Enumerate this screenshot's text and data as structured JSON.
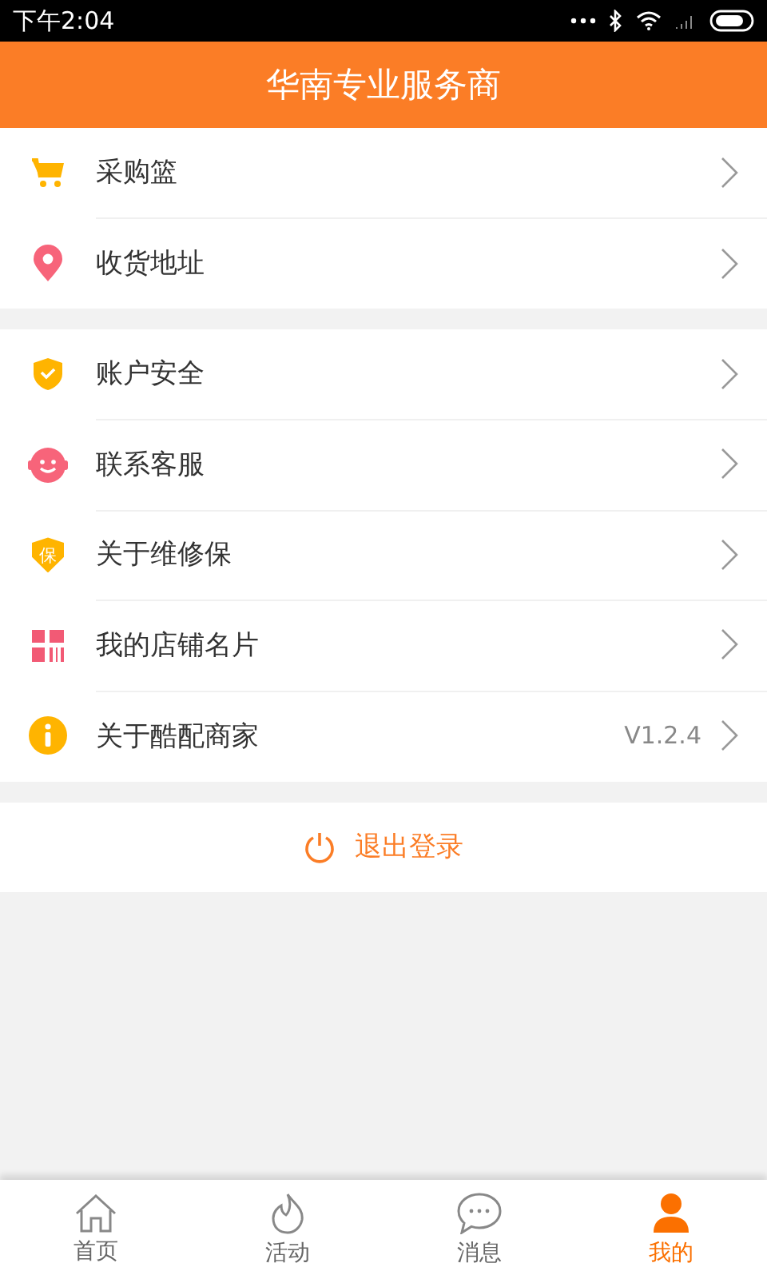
{
  "status_bar": {
    "time": "下午2:04"
  },
  "header": {
    "title": "华南专业服务商"
  },
  "groups": [
    {
      "items": [
        {
          "kind": "cart",
          "label": "采购篮"
        },
        {
          "kind": "pin",
          "label": "收货地址"
        }
      ]
    },
    {
      "items": [
        {
          "kind": "shield",
          "label": "账户安全"
        },
        {
          "kind": "headset",
          "label": "联系客服"
        },
        {
          "kind": "badge",
          "badge_text": "保",
          "label": "关于维修保"
        },
        {
          "kind": "qr",
          "label": "我的店铺名片"
        },
        {
          "kind": "info",
          "label": "关于酷配商家",
          "value": "V1.2.4"
        }
      ]
    }
  ],
  "logout": {
    "label": "退出登录"
  },
  "tabs": [
    {
      "kind": "home",
      "label": "首页",
      "selected": false
    },
    {
      "kind": "flame",
      "label": "活动",
      "selected": false
    },
    {
      "kind": "chat",
      "label": "消息",
      "selected": false
    },
    {
      "kind": "person",
      "label": "我的",
      "selected": true
    }
  ]
}
